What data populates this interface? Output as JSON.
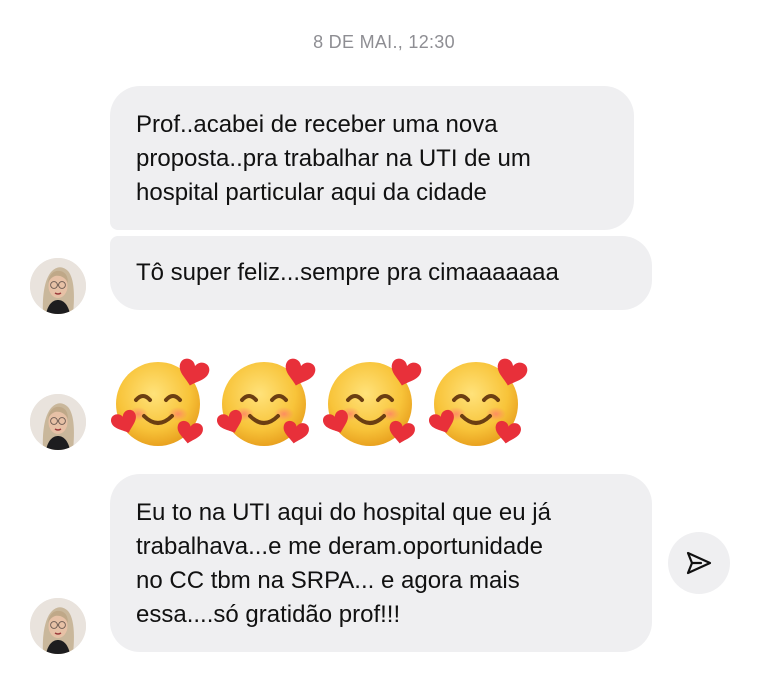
{
  "conversation": {
    "timestamp": "8 DE MAI., 12:30",
    "messages": [
      {
        "lines": [
          "Prof..acabei de receber uma nova",
          "proposta..pra trabalhar na UTI de um",
          "hospital particular aqui da cidade"
        ]
      },
      {
        "lines": [
          "Tô super feliz...sempre pra cimaaaaaaa"
        ]
      },
      {
        "emoji": [
          "smiling-face-with-hearts",
          "smiling-face-with-hearts",
          "smiling-face-with-hearts",
          "smiling-face-with-hearts"
        ]
      },
      {
        "lines": [
          "Eu to na UTI aqui do hospital que eu já",
          "trabalhava...e me deram.oportunidade",
          "no CC tbm na SRPA... e agora mais",
          "essa....só gratidão prof!!!"
        ]
      }
    ]
  },
  "icons": {
    "avatar": "avatar-photo",
    "share": "paper-plane-icon"
  },
  "colors": {
    "bubble_background": "#efeff1",
    "timestamp_text": "#8e8e93",
    "message_text": "#111111",
    "emoji_face": "#f8c43a",
    "emoji_heart": "#e8303a"
  }
}
